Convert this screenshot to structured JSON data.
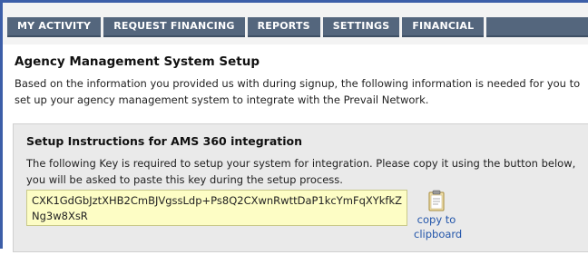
{
  "nav": {
    "tabs": [
      {
        "label": "MY ACTIVITY"
      },
      {
        "label": "REQUEST FINANCING"
      },
      {
        "label": "REPORTS"
      },
      {
        "label": "SETTINGS"
      },
      {
        "label": "FINANCIAL"
      }
    ]
  },
  "main": {
    "title": "Agency Management System Setup",
    "intro": "Based on the information you provided us with during signup, the following information is needed for you to set up your agency management system to integrate with the Prevail Network."
  },
  "panel": {
    "title": "Setup Instructions for AMS 360 integration",
    "text": "The following Key is required to setup your system for integration. Please copy it using the button below, you will be asked to paste this key during the setup process.",
    "key": "CXK1GdGbJztXHB2CmBJVgssLdp+Ps8Q2CXwnRwttDaP1kcYmFqXYkfkZNg3w8XsR",
    "copy_label": "copy to clipboard",
    "copy_icon": "clipboard-icon"
  },
  "colors": {
    "tab_bg": "#54667d",
    "frame_accent": "#3c5ea8",
    "key_bg": "#fdfdc5",
    "link": "#2255aa"
  }
}
